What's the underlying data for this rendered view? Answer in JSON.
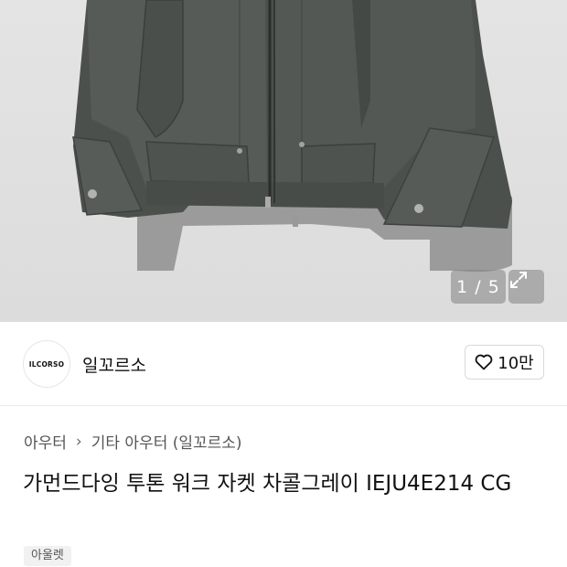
{
  "gallery": {
    "counter": "1 / 5",
    "expand_icon": "expand-arrows-icon"
  },
  "brand": {
    "logo_text": "ILCORSO",
    "name": "일꼬르소"
  },
  "like": {
    "icon": "heart-outline-icon",
    "count": "10만"
  },
  "breadcrumb": [
    "아우터",
    "기타 아우터 (일꼬르소)"
  ],
  "product": {
    "title": "가먼드다잉 투톤 워크 자켓 차콜그레이 IEJU4E214 CG",
    "badge": "아울렛"
  },
  "colors": {
    "jacket": "#4a4f4c",
    "background": "#e0e0e0"
  }
}
